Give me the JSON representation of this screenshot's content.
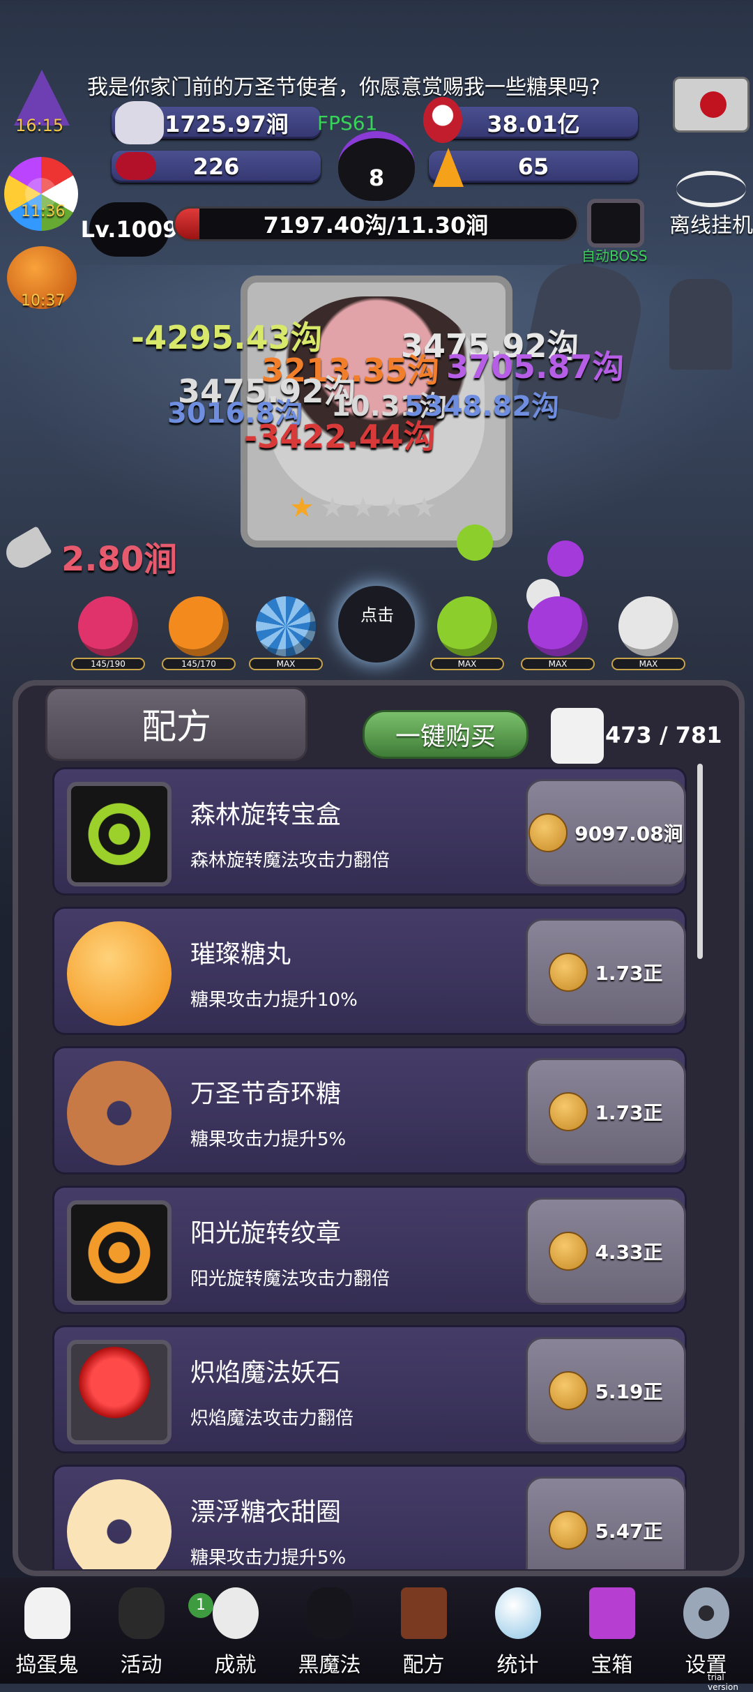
{
  "header": {
    "speech": "我是你家门前的万圣节使者，你愿意赏赐我一些糖果吗?",
    "timers": [
      "16:15",
      "11:36",
      "10:37"
    ],
    "stat_gold": "1725.97涧",
    "fps": "FPS61",
    "stat_potion": "38.01亿",
    "stat_candy_bow": "226",
    "cauldron_count": "8",
    "stat_corn": "65",
    "offline_label": "离线挂机",
    "auto_boss_label": "自动BOSS"
  },
  "level": {
    "label": "Lv.1009",
    "hp_text": "7197.40沟/11.30涧",
    "hp_fraction": 0.06
  },
  "battle": {
    "damage_texts": [
      "-4295.43沟",
      "3475.92沟",
      "3213.35沟",
      "3705.87沟",
      "3475.92沟",
      "3016.8沟",
      "10.31沟",
      "5348.82沟",
      "-3422.44沟"
    ],
    "axe_damage": "2.80涧",
    "click_label": "点击",
    "stars_filled": 1,
    "stars_total": 5
  },
  "monsters": [
    {
      "name": "pink-skull",
      "bar": "145/190",
      "color": "#e0336b"
    },
    {
      "name": "orange-skull",
      "bar": "145/170",
      "color": "#f28a1e"
    },
    {
      "name": "blue-candy",
      "bar": "MAX",
      "color": "#2d7cc9"
    },
    {
      "name": "black-cat",
      "bar": "",
      "color": "#1a1a22"
    },
    {
      "name": "green-skull",
      "bar": "MAX",
      "color": "#8ccf2c"
    },
    {
      "name": "purple-skull",
      "bar": "MAX",
      "color": "#a43ad9"
    },
    {
      "name": "white-skull",
      "bar": "MAX",
      "color": "#e6e6e6"
    }
  ],
  "panel": {
    "tab_label": "配方",
    "buy_all_label": "一键购买",
    "progress": "473 / 781"
  },
  "recipes": [
    {
      "name": "森林旋转宝盒",
      "desc": "森林旋转魔法攻击力翻倍",
      "price": "9097.08涧",
      "color": "#2f7a34"
    },
    {
      "name": "璀璨糖丸",
      "desc": "糖果攻击力提升10%",
      "price": "1.73正",
      "color": "#f59a14"
    },
    {
      "name": "万圣节奇环糖",
      "desc": "糖果攻击力提升5%",
      "price": "1.73正",
      "color": "#b86a3a"
    },
    {
      "name": "阳光旋转纹章",
      "desc": "阳光旋转魔法攻击力翻倍",
      "price": "4.33正",
      "color": "#e07d19"
    },
    {
      "name": "炽焰魔法妖石",
      "desc": "炽焰魔法攻击力翻倍",
      "price": "5.19正",
      "color": "#d61c1c"
    },
    {
      "name": "漂浮糖衣甜圈",
      "desc": "糖果攻击力提升5%",
      "price": "5.47正",
      "color": "#f2b15c"
    }
  ],
  "nav": [
    {
      "label": "捣蛋鬼",
      "icon": "ghost-icon"
    },
    {
      "label": "活动",
      "icon": "cake-icon"
    },
    {
      "label": "成就",
      "icon": "skull-trophy-icon",
      "badge": "1"
    },
    {
      "label": "黑魔法",
      "icon": "devil-icon"
    },
    {
      "label": "配方",
      "icon": "recipe-book-icon"
    },
    {
      "label": "统计",
      "icon": "crystal-ball-icon"
    },
    {
      "label": "宝箱",
      "icon": "gift-box-icon"
    },
    {
      "label": "设置",
      "icon": "gear-icon"
    }
  ],
  "watermark": "trial version"
}
